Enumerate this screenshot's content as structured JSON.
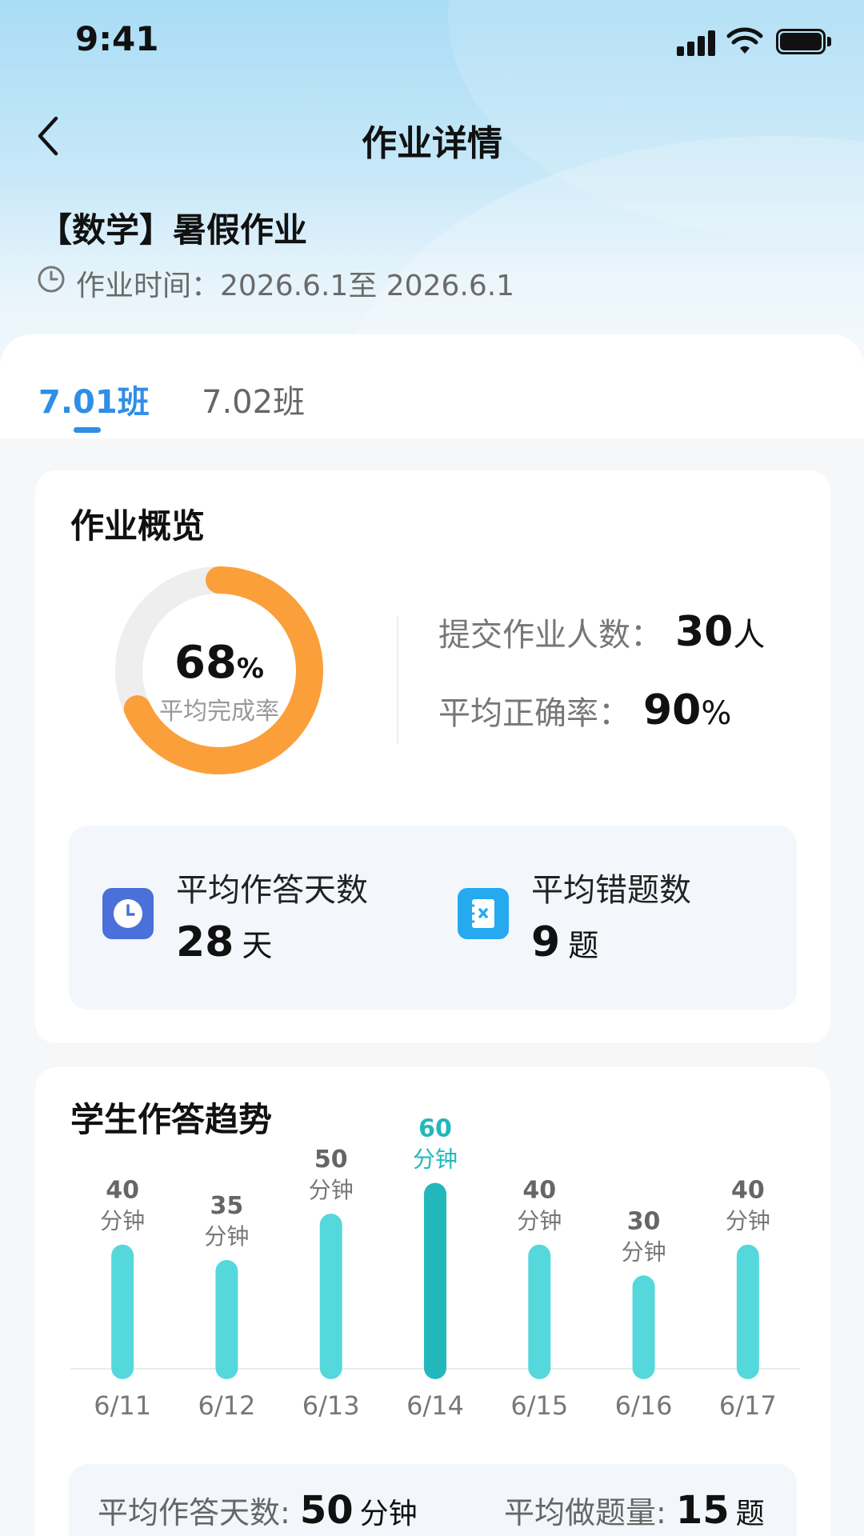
{
  "status_bar": {
    "time": "9:41"
  },
  "nav": {
    "title": "作业详情"
  },
  "homework": {
    "title": "【数学】暑假作业",
    "time_label": "作业时间：2026.6.1至 2026.6.1"
  },
  "tabs": [
    {
      "label": "7.01班",
      "active": true
    },
    {
      "label": "7.02班",
      "active": false
    }
  ],
  "overview": {
    "title": "作业概览",
    "completion_value": "68",
    "completion_unit": "%",
    "completion_fraction": 0.68,
    "completion_label": "平均完成率",
    "submit_label": "提交作业人数：",
    "submit_value": "30",
    "submit_unit": "人",
    "accuracy_label": "平均正确率：",
    "accuracy_value": "90",
    "accuracy_unit": "%",
    "days_label": "平均作答天数",
    "days_value": "28",
    "days_unit": "天",
    "wrong_label": "平均错题数",
    "wrong_value": "9",
    "wrong_unit": "题"
  },
  "trend": {
    "title": "学生作答趋势",
    "summary": {
      "days_label": "平均作答天数:",
      "days_value": "50",
      "days_unit": "分钟",
      "questions_label": "平均做题量:",
      "questions_value": "15",
      "questions_unit": "题"
    }
  },
  "colors": {
    "accent": "#2f8ee6",
    "donut_fill": "#fb9f3a",
    "donut_track": "#eeeeee",
    "bar": "#55d8dc",
    "bar_highlight": "#22b8bb",
    "days_icon_bg": "#4a70d9",
    "wrong_icon_bg": "#25a9ef"
  },
  "chart_data": {
    "type": "bar",
    "categories": [
      "6/11",
      "6/12",
      "6/13",
      "6/14",
      "6/15",
      "6/16",
      "6/17"
    ],
    "values": [
      40,
      35,
      50,
      60,
      40,
      30,
      40
    ],
    "value_unit": "分钟",
    "highlight_index": 3,
    "ylim": [
      0,
      70
    ],
    "grid": false
  }
}
